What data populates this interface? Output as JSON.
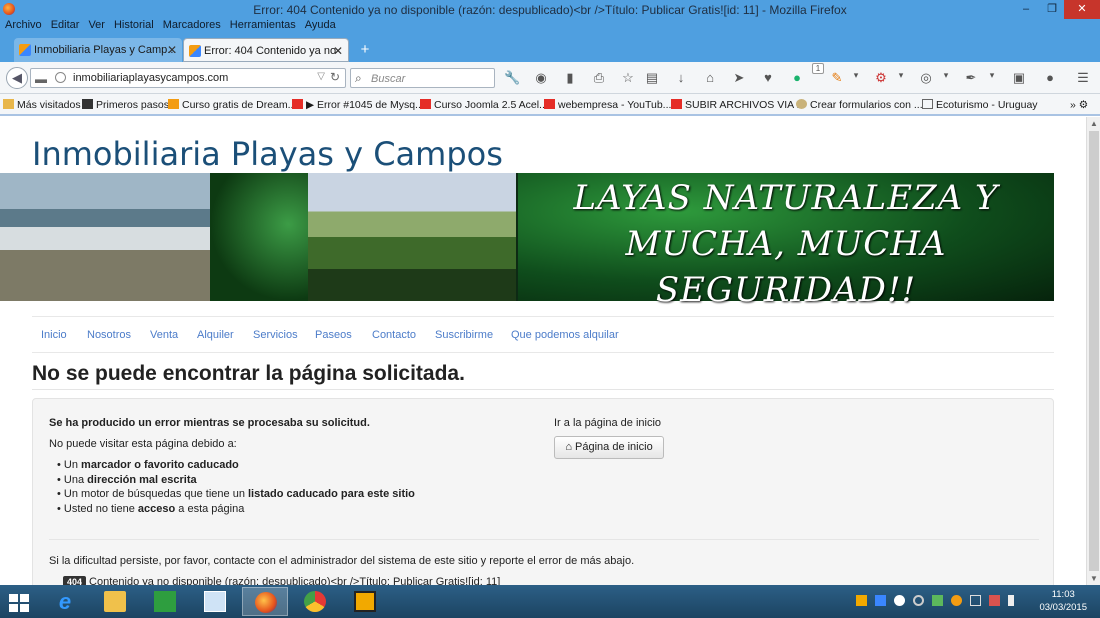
{
  "window": {
    "title": "Error: 404 Contenido ya no disponible (razón: despublicado)<br />Título: Publicar Gratis![id: 11] - Mozilla Firefox",
    "minimize": "–",
    "maximize": "❐",
    "close": "✕"
  },
  "menu": [
    "Archivo",
    "Editar",
    "Ver",
    "Historial",
    "Marcadores",
    "Herramientas",
    "Ayuda"
  ],
  "tabs": [
    {
      "label": "Inmobiliaria Playas y Camp...",
      "close": "✕"
    },
    {
      "label": "Error: 404 Contenido ya no ...",
      "close": "✕"
    }
  ],
  "new_tab": "+",
  "navbar": {
    "url": "inmobiliariaplayasycampos.com",
    "search_placeholder": "Buscar",
    "badge": "1"
  },
  "bookmarks": [
    "Más visitados",
    "Primeros pasos",
    "Curso gratis de Dream...",
    "▶ Error #1045 de Mysq...",
    "Curso Joomla 2.5 Acel...",
    "webempresa - YouTub...",
    "SUBIR ARCHIVOS VIA ...",
    "Crear formularios con ...",
    "Ecoturismo - Uruguay"
  ],
  "site": {
    "title": "Inmobiliaria Playas y Campos",
    "banner_text": "LAYAS NATURALEZA Y\nMUCHA, MUCHA\nSEGURIDAD!!",
    "nav": [
      "Inicio",
      "Nosotros",
      "Venta",
      "Alquiler",
      "Servicios",
      "Paseos",
      "Contacto",
      "Suscribirme",
      "Que podemos alquilar"
    ]
  },
  "error": {
    "heading": "No se puede encontrar la página solicitada.",
    "box_title": "Se ha producido un error mientras se procesaba su solicitud.",
    "intro": "No puede visitar esta página debido a:",
    "reasons": [
      {
        "pre": "Un ",
        "strong": "marcador o favorito caducado",
        "post": ""
      },
      {
        "pre": "Una ",
        "strong": "dirección mal escrita",
        "post": ""
      },
      {
        "pre": "Un motor de búsquedas que tiene un ",
        "strong": "listado caducado para este sitio",
        "post": ""
      },
      {
        "pre": "Usted no tiene ",
        "strong": "acceso",
        "post": " a esta página"
      }
    ],
    "home_label": "Ir a la página de inicio",
    "home_button": "Página de inicio",
    "contact": "Si la dificultad persiste, por favor, contacte con el administrador del sistema de este sitio y reporte el error de más abajo.",
    "code": "404",
    "code_text": "Contenido ya no disponible (razón: despublicado)<br />Título: Publicar Gratis![id: 11]"
  },
  "clock": {
    "time": "11:03",
    "date": "03/03/2015"
  }
}
